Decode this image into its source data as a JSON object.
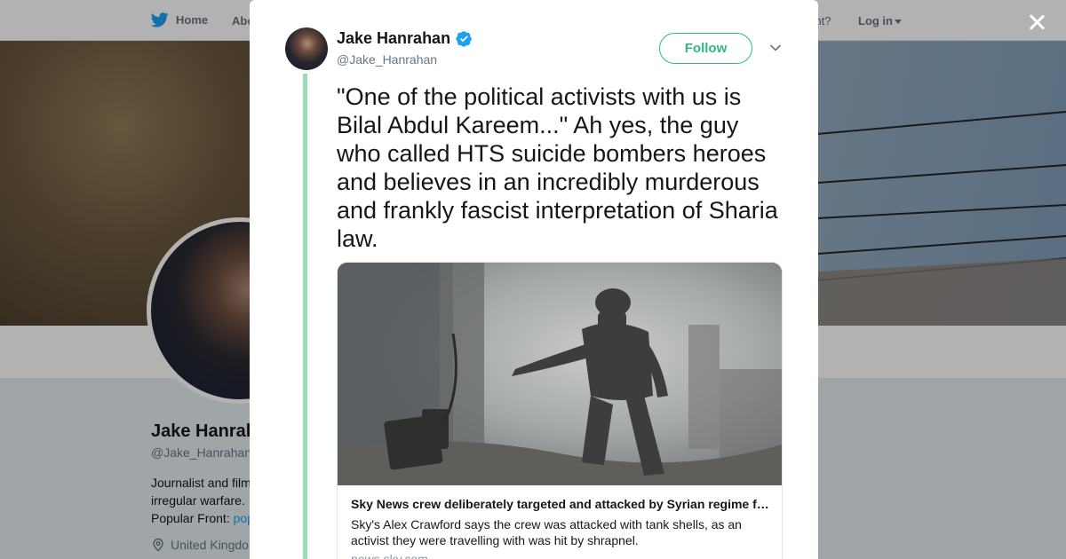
{
  "nav": {
    "home_label": "Home",
    "about_label": "Abo",
    "account_text": "ccount?",
    "login_label": "Log in"
  },
  "profile": {
    "name": "Jake Hanrah",
    "handle": "@Jake_Hanrahan",
    "bio_line1": "Journalist and film",
    "bio_line2": "irregular warfare.",
    "bio_line3_prefix": "Popular Front: ",
    "bio_link": "pop",
    "location": "United Kingdo"
  },
  "tweet": {
    "author_name": "Jake Hanrahan",
    "author_handle": "@Jake_Hanrahan",
    "follow_label": "Follow",
    "text": "\"One of the political activists with us is Bilal Abdul Kareem...\" Ah yes, the guy who called HTS suicide bombers heroes and believes in an incredibly murderous and frankly fascist interpretation of Sharia law.",
    "card": {
      "title": "Sky News crew deliberately targeted and attacked by Syrian regime forces",
      "description": "Sky's Alex Crawford says the crew was attacked with tank shells, as an activist they were travelling with was hit by shrapnel.",
      "domain": "news.sky.com"
    }
  },
  "colors": {
    "follow_accent": "#2fb981",
    "thread_line": "#96deb8",
    "verified_blue": "#1da1f2",
    "twitter_blue": "#1da1f2"
  },
  "icons": {
    "logo": "twitter-bird-icon",
    "verified": "verified-badge-icon",
    "close": "close-icon",
    "caret": "chevron-down-icon",
    "location": "location-pin-icon"
  }
}
